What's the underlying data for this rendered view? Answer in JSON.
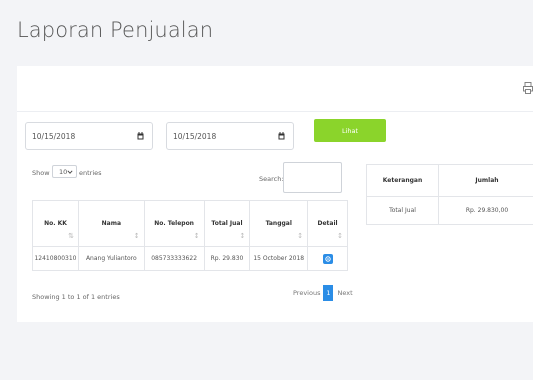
{
  "page": {
    "title": "Laporan Penjualan"
  },
  "filters": {
    "start_date": "10/15/2018",
    "end_date": "10/15/2018",
    "submit_label": "Lihat"
  },
  "datatable": {
    "show_label": "Show",
    "length_value": "10",
    "entries_label": "entries",
    "search_label": "Search:",
    "search_value": "",
    "columns": [
      "No. KK",
      "Nama",
      "No. Telepon",
      "Total Jual",
      "Tanggal",
      "Detail"
    ],
    "rows": [
      {
        "no_kk": "12410800310",
        "nama": "Anang Yuliantoro",
        "telepon": "085733333622",
        "total": "Rp. 29.830",
        "tanggal": "15 October 2018"
      }
    ],
    "info": "Showing 1 to 1 of 1 entries",
    "pagination": {
      "previous": "Previous",
      "current": "1",
      "next": "Next"
    }
  },
  "summary": {
    "columns": [
      "Keterangan",
      "Jumlah"
    ],
    "rows": [
      {
        "keterangan": "Total Jual",
        "jumlah": "Rp. 29.830,00"
      }
    ]
  },
  "icons": {
    "print": "print-icon",
    "calendar": "calendar-icon",
    "detail": "detail-icon",
    "dropdown": "chevron-down-icon"
  },
  "colors": {
    "primary": "#2b8de6",
    "submit": "#8bd42b",
    "background": "#f3f4f7"
  }
}
